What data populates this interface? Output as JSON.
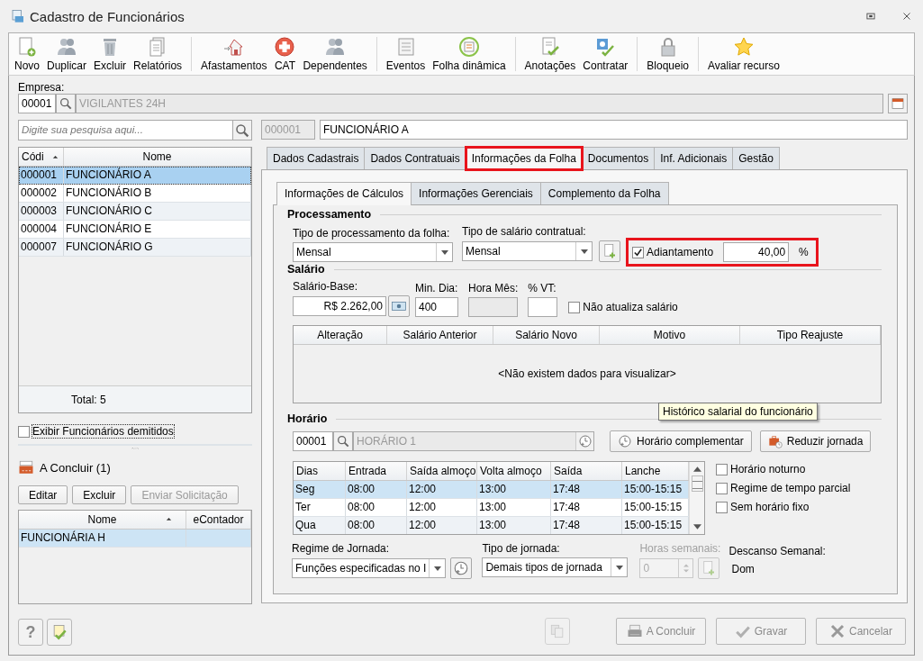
{
  "window": {
    "title": "Cadastro de Funcionários"
  },
  "toolbar": [
    [
      {
        "label": "Novo",
        "kind": "new"
      },
      {
        "label": "Duplicar",
        "kind": "people"
      },
      {
        "label": "Excluir",
        "kind": "trash"
      },
      {
        "label": "Relatórios",
        "kind": "report"
      }
    ],
    [
      {
        "label": "Afastamentos",
        "kind": "house"
      },
      {
        "label": "CAT",
        "kind": "cross"
      },
      {
        "label": "Dependentes",
        "kind": "people"
      }
    ],
    [
      {
        "label": "Eventos",
        "kind": "list"
      },
      {
        "label": "Folha dinâmica",
        "kind": "calendar"
      }
    ],
    [
      {
        "label": "Anotações",
        "kind": "notes"
      },
      {
        "label": "Contratar",
        "kind": "hire"
      }
    ],
    [
      {
        "label": "Bloqueio",
        "kind": "lock"
      }
    ],
    [
      {
        "label": "Avaliar recurso",
        "kind": "star"
      }
    ]
  ],
  "empresa": {
    "label": "Empresa:",
    "code": "00001",
    "name": "VIGILANTES 24H"
  },
  "search": {
    "placeholder": "Digite sua pesquisa aqui..."
  },
  "employee_list": {
    "columns": [
      "Códi",
      "Nome"
    ],
    "rows": [
      {
        "code": "000001",
        "name": "FUNCIONÁRIO A",
        "selected": true
      },
      {
        "code": "000002",
        "name": "FUNCIONÁRIO B",
        "selected": false
      },
      {
        "code": "000003",
        "name": "FUNCIONÁRIO C",
        "selected": false
      },
      {
        "code": "000004",
        "name": "FUNCIONÁRIO E",
        "selected": false
      },
      {
        "code": "000007",
        "name": "FUNCIONÁRIO G",
        "selected": false
      }
    ],
    "total": "Total: 5"
  },
  "show_dismissed": {
    "label": "Exibir Funcionários demitidos",
    "checked": false
  },
  "pending": {
    "title": "A Concluir (1)",
    "buttons": [
      {
        "label": "Editar",
        "disabled": false
      },
      {
        "label": "Excluir",
        "disabled": false
      },
      {
        "label": "Enviar Solicitação",
        "disabled": true
      }
    ],
    "columns": [
      "Nome",
      "eContador"
    ],
    "rows": [
      {
        "name": "FUNCIONÁRIA H",
        "selected": true
      }
    ]
  },
  "bottom_left": {
    "help": "?"
  },
  "employee_header": {
    "code": "000001",
    "name": "FUNCIONÁRIO A"
  },
  "tabs": [
    {
      "label": "Dados Cadastrais",
      "selected": false,
      "highlighted": false
    },
    {
      "label": "Dados Contratuais",
      "selected": false,
      "highlighted": false
    },
    {
      "label": "Informações da Folha",
      "selected": true,
      "highlighted": true
    },
    {
      "label": "Documentos",
      "selected": false,
      "highlighted": false
    },
    {
      "label": "Inf. Adicionais",
      "selected": false,
      "highlighted": false
    },
    {
      "label": "Gestão",
      "selected": false,
      "highlighted": false
    }
  ],
  "subtabs": [
    {
      "label": "Informações de Cálculos",
      "selected": true
    },
    {
      "label": "Informações Gerenciais",
      "selected": false
    },
    {
      "label": "Complemento da Folha",
      "selected": false
    }
  ],
  "processamento": {
    "title": "Processamento",
    "tipo_processamento": {
      "label": "Tipo de processamento da folha:",
      "value": "Mensal"
    },
    "tipo_salario": {
      "label": "Tipo de salário contratual:",
      "value": "Mensal"
    },
    "adiantamento": {
      "label": "Adiantamento",
      "checked": true,
      "value": "40,00",
      "unit": "%",
      "highlighted": true
    }
  },
  "salario": {
    "title": "Salário",
    "base": {
      "label": "Salário-Base:",
      "value": "R$ 2.262,00"
    },
    "min_dia": {
      "label": "Min. Dia:",
      "value": "400"
    },
    "hora_mes": {
      "label": "Hora Mês:"
    },
    "vt": {
      "label": "% VT:"
    },
    "nao_atualiza": {
      "label": "Não atualiza salário",
      "checked": false
    },
    "history": {
      "columns": [
        "Alteração",
        "Salário Anterior",
        "Salário Novo",
        "Motivo",
        "Tipo Reajuste"
      ],
      "empty": "<Não existem dados para visualizar>"
    }
  },
  "tooltip": "Histórico salarial do funcionário",
  "horario": {
    "title": "Horário",
    "code": "00001",
    "name": "HORÁRIO 1",
    "buttons": [
      {
        "label": "Horário complementar",
        "kind": "clock"
      },
      {
        "label": "Reduzir jornada",
        "kind": "briefcase"
      }
    ],
    "columns": [
      "Dias",
      "Entrada",
      "Saída almoço",
      "Volta almoço",
      "Saída",
      "Lanche"
    ],
    "rows": [
      {
        "cells": [
          "Seg",
          "08:00",
          "12:00",
          "13:00",
          "17:48",
          "15:00-15:15"
        ],
        "selected": true
      },
      {
        "cells": [
          "Ter",
          "08:00",
          "12:00",
          "13:00",
          "17:48",
          "15:00-15:15"
        ],
        "selected": false
      },
      {
        "cells": [
          "Qua",
          "08:00",
          "12:00",
          "13:00",
          "17:48",
          "15:00-15:15"
        ],
        "selected": false
      }
    ],
    "options": [
      {
        "label": "Horário noturno",
        "checked": false
      },
      {
        "label": "Regime de tempo parcial",
        "checked": false
      },
      {
        "label": "Sem horário fixo",
        "checked": false
      }
    ]
  },
  "jornada": {
    "regime": {
      "label": "Regime de Jornada:",
      "value": "Funções especificadas no I"
    },
    "tipo": {
      "label": "Tipo de jornada:",
      "value": "Demais tipos de jornada"
    },
    "horas": {
      "label": "Horas semanais:",
      "value": "0",
      "disabled": true
    },
    "descanso": {
      "label": "Descanso Semanal:",
      "value": "Dom"
    }
  },
  "footer_buttons": [
    {
      "label": "A Concluir",
      "kind": "printer",
      "disabled": true
    },
    {
      "label": "Gravar",
      "kind": "check",
      "disabled": true
    },
    {
      "label": "Cancelar",
      "kind": "x",
      "disabled": true
    }
  ]
}
